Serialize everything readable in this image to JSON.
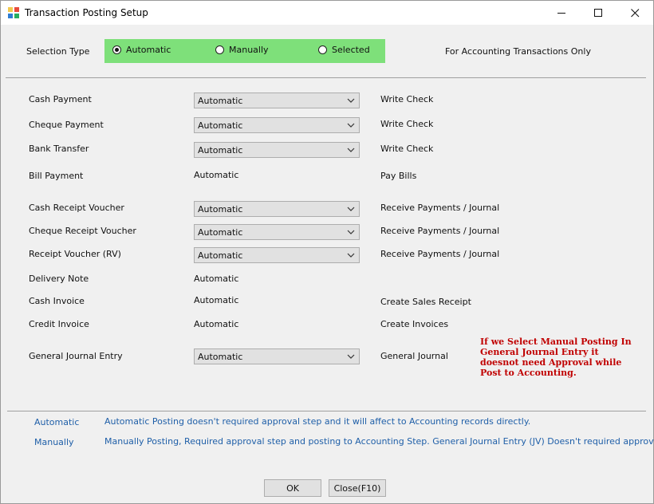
{
  "window": {
    "title": "Transaction Posting Setup"
  },
  "selection": {
    "label": "Selection Type",
    "options": [
      {
        "label": "Automatic",
        "selected": true
      },
      {
        "label": "Manually",
        "selected": false
      },
      {
        "label": "Selected",
        "selected": false
      }
    ],
    "panel_color": "#7ee07a",
    "note": "For Accounting Transactions Only"
  },
  "rows": [
    {
      "label": "Cash Payment",
      "value": "Automatic",
      "target": "Write Check"
    },
    {
      "label": "Cheque Payment",
      "value": "Automatic",
      "target": "Write Check"
    },
    {
      "label": "Bank Transfer",
      "value": "Automatic",
      "target": "Write Check"
    },
    {
      "label": "Bill Payment",
      "value": "Automatic",
      "target": "Pay Bills"
    },
    {
      "label": "Cash Receipt Voucher",
      "value": "Automatic",
      "target": "Receive Payments / Journal"
    },
    {
      "label": "Cheque Receipt Voucher",
      "value": "Automatic",
      "target": "Receive Payments / Journal"
    },
    {
      "label": "Receipt Voucher (RV)",
      "value": "Automatic",
      "target": "Receive Payments / Journal"
    },
    {
      "label": "Delivery Note",
      "value": "Automatic",
      "target": ""
    },
    {
      "label": "Cash Invoice",
      "value": "Automatic",
      "target": "Create Sales Receipt"
    },
    {
      "label": "Credit Invoice",
      "value": "Automatic",
      "target": "Create Invoices"
    },
    {
      "label": "General Journal Entry",
      "value": "Automatic",
      "target": "General Journal"
    }
  ],
  "warning": "If we Select Manual Posting In General Journal Entry  it doesnot need Approval while Post to Accounting.",
  "legend": [
    {
      "key": "Automatic",
      "text": "Automatic Posting doesn't required approval step and it will affect to Accounting records directly."
    },
    {
      "key": "Manually",
      "text": "Manually Posting, Required approval step and posting to Accounting Step. General Journal Entry (JV) Doesn't required approval"
    }
  ],
  "buttons": {
    "ok": "OK",
    "close": "Close(F10)"
  },
  "colors": {
    "legend_text": "#1f5fa8",
    "warning_text": "#c00000"
  }
}
